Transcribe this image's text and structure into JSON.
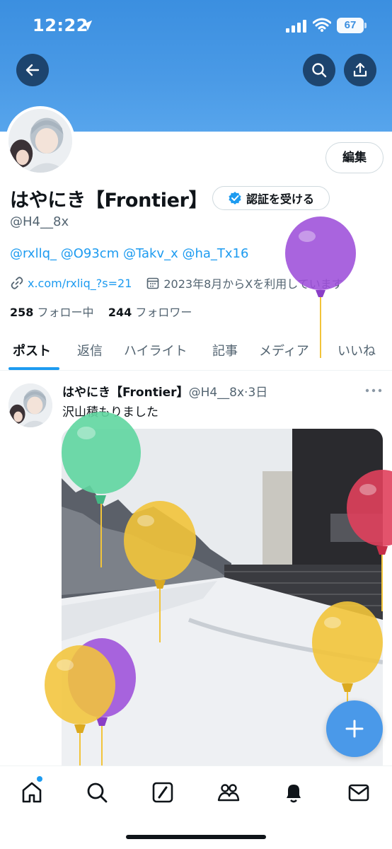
{
  "status_bar": {
    "time": "12:22",
    "battery": "67"
  },
  "header": {
    "back_icon": "arrow-left-icon",
    "search_icon": "search-icon",
    "share_icon": "share-icon"
  },
  "profile": {
    "edit_label": "編集",
    "display_name": "はやにき【Frontier】",
    "verify_label": "認証を受ける",
    "handle": "@H4__8x",
    "bio": "@rxllq_ @O93cm @Takv_x @ha_Tx16",
    "link": "x.com/rxliq_?s=21",
    "joined": "2023年8月からXを利用しています",
    "following_count": "258",
    "following_label": "フォロー中",
    "followers_count": "244",
    "followers_label": "フォロワー"
  },
  "tabs": [
    "ポスト",
    "返信",
    "ハイライト",
    "記事",
    "メディア",
    "いいね"
  ],
  "post": {
    "name": "はやにき【Frontier】",
    "meta": "@H4__8x·3日",
    "text": "沢山積もりました"
  },
  "balloon_colors": [
    "#9d4fd9",
    "#5fd6a0",
    "#f2c43a",
    "#e0405c"
  ],
  "bottom_nav": [
    "home-icon",
    "search-icon",
    "grok-icon",
    "communities-icon",
    "notifications-icon",
    "messages-icon"
  ]
}
